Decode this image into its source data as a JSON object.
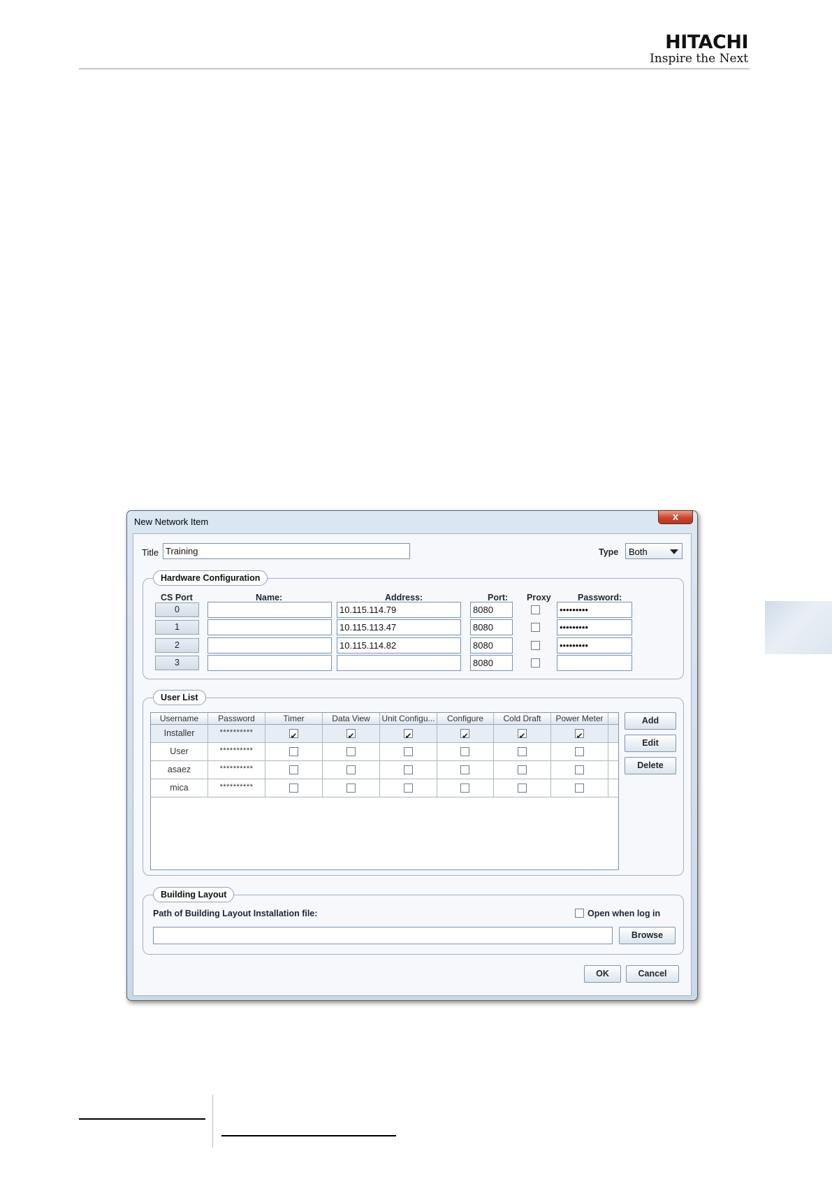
{
  "header": {
    "logo_main": "HITACHI",
    "logo_tagline": "Inspire the Next"
  },
  "dialog": {
    "window_title": "New Network Item",
    "close_glyph": "x",
    "title_label": "Title",
    "title_value": "Training",
    "type_label": "Type",
    "type_value": "Both",
    "hardware": {
      "group_title": "Hardware Configuration",
      "headers": {
        "cs_port": "CS Port",
        "name": "Name:",
        "address": "Address:",
        "port": "Port:",
        "proxy": "Proxy",
        "password": "Password:"
      },
      "rows": [
        {
          "cs_port": "0",
          "name": "",
          "address": "10.115.114.79",
          "port": "8080",
          "proxy": false,
          "password": "•••••••••"
        },
        {
          "cs_port": "1",
          "name": "",
          "address": "10.115.113.47",
          "port": "8080",
          "proxy": false,
          "password": "•••••••••"
        },
        {
          "cs_port": "2",
          "name": "",
          "address": "10.115.114.82",
          "port": "8080",
          "proxy": false,
          "password": "•••••••••"
        },
        {
          "cs_port": "3",
          "name": "",
          "address": "",
          "port": "8080",
          "proxy": false,
          "password": ""
        }
      ]
    },
    "users": {
      "group_title": "User List",
      "columns": [
        "Username",
        "Password",
        "Timer",
        "Data View",
        "Unit Configu...",
        "Configure",
        "Cold Draft",
        "Power Meter"
      ],
      "rows": [
        {
          "username": "Installer",
          "password": "**********",
          "perms": [
            true,
            true,
            true,
            true,
            true,
            true
          ]
        },
        {
          "username": "User",
          "password": "**********",
          "perms": [
            false,
            false,
            false,
            false,
            false,
            false
          ]
        },
        {
          "username": "asaez",
          "password": "**********",
          "perms": [
            false,
            false,
            false,
            false,
            false,
            false
          ]
        },
        {
          "username": "mica",
          "password": "**********",
          "perms": [
            false,
            false,
            false,
            false,
            false,
            false
          ]
        }
      ],
      "add_label": "Add",
      "edit_label": "Edit",
      "delete_label": "Delete"
    },
    "building": {
      "group_title": "Building Layout",
      "path_label": "Path of Building Layout Installation file:",
      "path_value": "",
      "open_when_log_in_label": "Open when log in",
      "open_when_log_in": false,
      "browse_label": "Browse"
    },
    "ok_label": "OK",
    "cancel_label": "Cancel"
  }
}
